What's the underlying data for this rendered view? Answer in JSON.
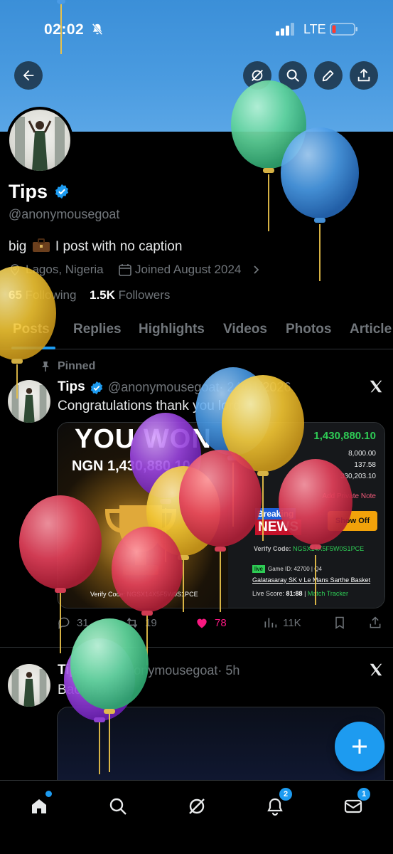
{
  "status_bar": {
    "time": "02:02",
    "network": "LTE"
  },
  "profile": {
    "name": "Tips",
    "handle": "@anonymousegoat",
    "bio_before": "big",
    "bio_after": "I post with no caption",
    "location": "Lagos, Nigeria",
    "joined": "Joined August 2024",
    "following_count": "65",
    "following_label": "Following",
    "followers_count": "1.5K",
    "followers_label": "Followers"
  },
  "tabs": [
    {
      "label": "Posts",
      "active": true
    },
    {
      "label": "Replies"
    },
    {
      "label": "Highlights"
    },
    {
      "label": "Videos"
    },
    {
      "label": "Photos"
    },
    {
      "label": "Article"
    }
  ],
  "pinned_label": "Pinned",
  "posts": [
    {
      "name": "Tips",
      "handle": "@anonymousegoat",
      "time": "· 24/01/2026",
      "text": "Congratulations thank you lord",
      "media": {
        "headline": "YOU WON",
        "amount": "NGN 1,430,880.10",
        "verify_left": "Verify Code: NGSX14X5F5W0S1PCE",
        "amount_big": "1,430,880.10",
        "stake": "8,000.00",
        "odds": "137.58",
        "total": "330,203.10",
        "private_note": "Add Private Note",
        "breaking": "Breaking",
        "news": "NEWS",
        "show_off": "Show Off",
        "verify_right_label": "Verify Code:",
        "verify_right_code": "NGSX14X5F5W0S1PCE",
        "live": "live",
        "game_id": "Game ID: 42700 | Q4",
        "match": "Galatasaray SK v Le Mans Sarthe Basket",
        "live_score_label": "Live Score:",
        "live_score": "81:88",
        "match_tracker": "Match Tracker"
      },
      "replies": "31",
      "reposts": "19",
      "likes": "78",
      "views": "11K"
    },
    {
      "name": "Tips",
      "handle": "@anonymousegoat",
      "time": "· 5h",
      "text": "Back home"
    }
  ],
  "nav": {
    "notifications_badge": "2",
    "messages_badge": "1"
  },
  "colors": {
    "accent": "#1d9bf0",
    "like": "#f91880",
    "banner": "#4a9be0"
  }
}
